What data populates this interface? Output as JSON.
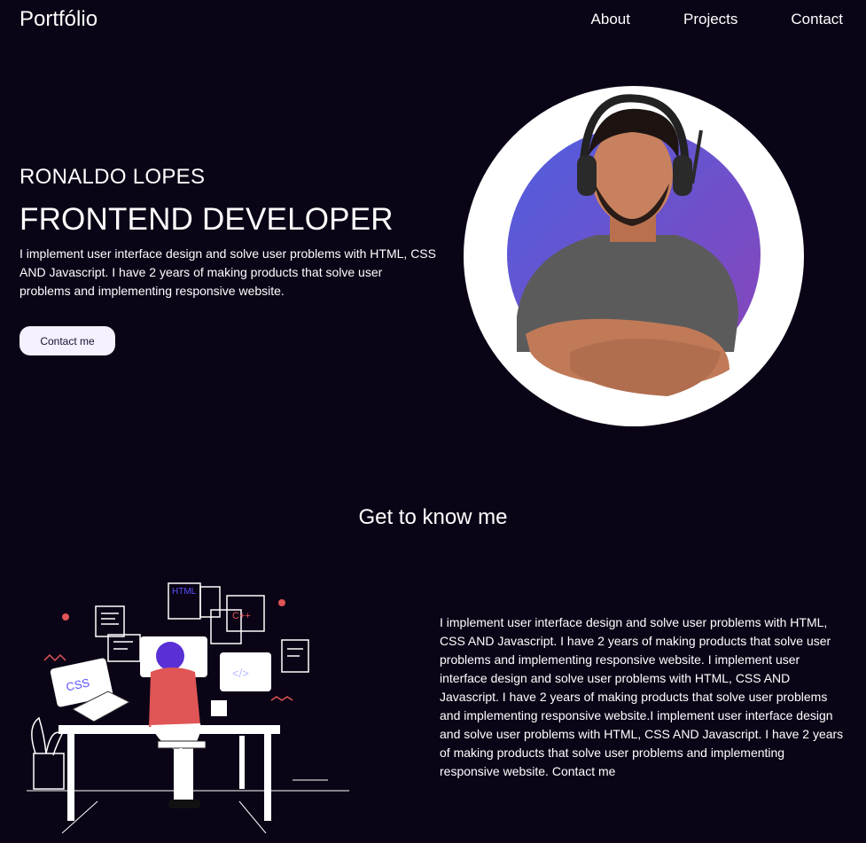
{
  "nav": {
    "brand": "Portfólio",
    "links": [
      "About",
      "Projects",
      "Contact"
    ]
  },
  "hero": {
    "name": "RONALDO LOPES",
    "role": "FRONTEND DEVELOPER",
    "description": "I implement user interface design and solve user problems with HTML, CSS AND Javascript. I have 2 years of making products that solve user problems and implementing responsive website.",
    "button_label": "Contact me"
  },
  "about": {
    "title": "Get to know me",
    "text": "I implement user interface design and solve user problems with HTML, CSS AND Javascript. I have 2 years of making products that solve user problems and implementing responsive website. I implement user interface design and solve user problems with HTML, CSS AND Javascript. I have 2 years of making products that solve user problems and implementing responsive website.I implement user interface design and solve user problems with HTML, CSS AND Javascript. I have 2 years of making products that solve user problems and implementing responsive website. Contact me"
  },
  "illustration": {
    "screen_labels": [
      "HTML",
      "C++",
      "CSS"
    ]
  },
  "colors": {
    "background": "#0b0416",
    "button_bg": "#f6f0ff",
    "avatar_gradient_start": "#4f5fe0",
    "avatar_gradient_end": "#8a44b8",
    "accent_red": "#e05555"
  }
}
